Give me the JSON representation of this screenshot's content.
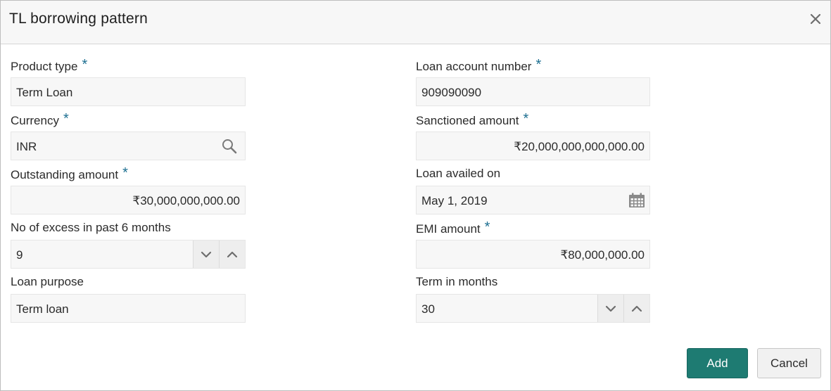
{
  "dialog": {
    "title": "TL borrowing pattern"
  },
  "required_marker": "*",
  "fields": {
    "product_type": {
      "label": "Product type",
      "value": "Term Loan",
      "required": true
    },
    "loan_account_number": {
      "label": "Loan account number",
      "value": "909090090",
      "required": true
    },
    "currency": {
      "label": "Currency",
      "value": "INR",
      "required": true,
      "icon": "search-icon"
    },
    "sanctioned_amount": {
      "label": "Sanctioned amount",
      "value": "₹20,000,000,000,000.00",
      "required": true
    },
    "outstanding_amount": {
      "label": "Outstanding amount",
      "value": "₹30,000,000,000.00",
      "required": true
    },
    "loan_availed_on": {
      "label": "Loan availed on",
      "value": "May 1, 2019",
      "required": false,
      "icon": "calendar-icon"
    },
    "no_of_excess": {
      "label": "No of excess in past 6 months",
      "value": "9",
      "required": false
    },
    "emi_amount": {
      "label": "EMI amount",
      "value": "₹80,000,000.00",
      "required": true
    },
    "loan_purpose": {
      "label": "Loan purpose",
      "value": "Term loan",
      "required": false
    },
    "term_in_months": {
      "label": "Term in months",
      "value": "30",
      "required": false
    }
  },
  "buttons": {
    "add": "Add",
    "cancel": "Cancel"
  },
  "colors": {
    "accent": "#1e7b72",
    "required": "#1d6f91",
    "field_bg": "#f7f7f7"
  }
}
